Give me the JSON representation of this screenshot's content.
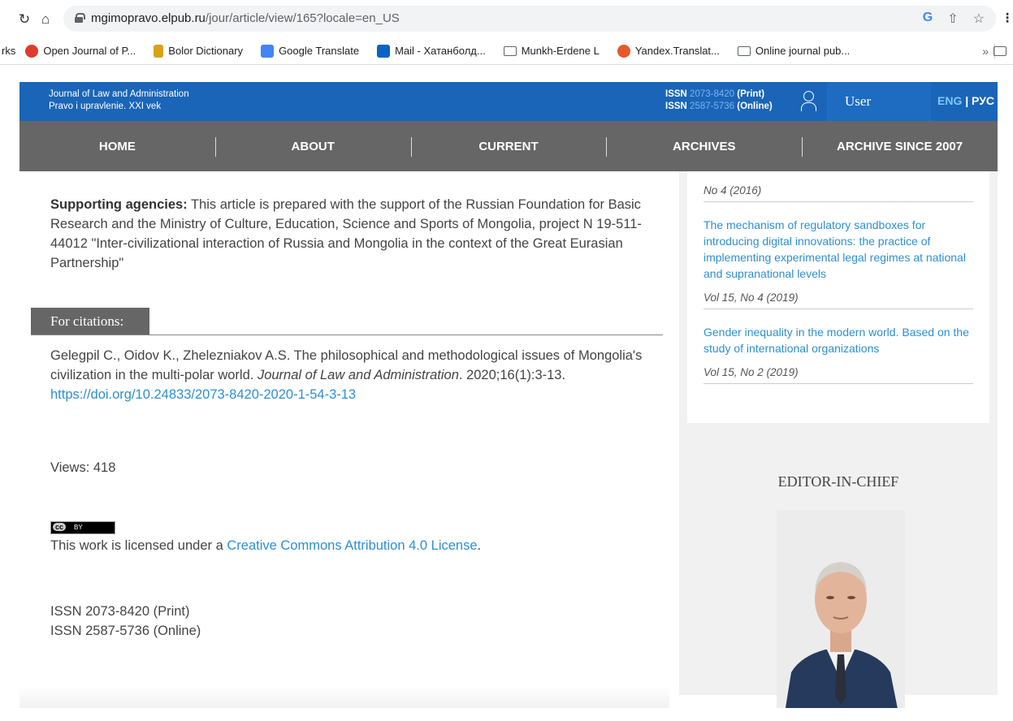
{
  "browser": {
    "back_icon": "↻",
    "home_icon": "⌂",
    "url_domain": "mgimopravo.elpub.ru",
    "url_path": "/jour/article/view/165?locale=en_US",
    "bookmarks": [
      {
        "label": "rks",
        "icon": "none"
      },
      {
        "label": "Open Journal of P...",
        "icon": "ojs-icon",
        "color": "#e03c2e"
      },
      {
        "label": "Bolor Dictionary",
        "icon": "bolor-icon",
        "color": "#d9a21b"
      },
      {
        "label": "Google Translate",
        "icon": "translate-icon",
        "color": "#4285f4"
      },
      {
        "label": "Mail - Хатанболд...",
        "icon": "outlook-icon",
        "color": "#0a64c4"
      },
      {
        "label": "Munkh-Erdene L",
        "icon": "folder-icon"
      },
      {
        "label": "Yandex.Translat...",
        "icon": "yandex-icon",
        "color": "#e8572a"
      },
      {
        "label": "Online journal pub...",
        "icon": "folder-icon"
      }
    ],
    "more_label": "»"
  },
  "header": {
    "journal_line1": "Journal of Law and Administration",
    "journal_line2": "Pravo i upravlenie. XXI vek",
    "issn_label": "ISSN",
    "issn_print_num": "2073-8420",
    "issn_print_type": "(Print)",
    "issn_online_num": "2587-5736",
    "issn_online_type": "(Online)",
    "user_label": "User",
    "lang_eng": "ENG",
    "lang_sep": " | ",
    "lang_rus": "РУС"
  },
  "menu": [
    "HOME",
    "ABOUT",
    "CURRENT",
    "ARCHIVES",
    "ARCHIVE SINCE 2007"
  ],
  "article": {
    "support_label": "Supporting agencies:",
    "support_text": " This article is prepared with the support of the Russian Foundation for Basic Research and the Ministry of Culture, Education, Science and Sports of Mongolia, project N 19-511-44012 \"Inter-civilizational interaction of Russia and Mongolia in the context of the Great Eurasian Partnership\"",
    "citations_heading": "For citations:",
    "citation_authors": "Gelegpil C., Oidov K., Zhelezniakov A.S. The philosophical and methodological issues of Mongolia's civilization in the multi-polar world. ",
    "citation_journal": "Journal of Law and Administration",
    "citation_rest": ". 2020;16(1):3-13. ",
    "citation_doi": "https://doi.org/10.24833/2073-8420-2020-1-54-3-13",
    "views": "Views: 418",
    "cc_badge": "cc",
    "cc_by": "BY",
    "license_prefix": "This work is licensed under a ",
    "license_link": "Creative Commons Attribution 4.0 License",
    "license_suffix": ".",
    "issn_print": "ISSN 2073-8420 (Print)",
    "issn_online": "ISSN 2587-5736 (Online)"
  },
  "sidebar": {
    "top_meta": "No 4 (2016)",
    "related": [
      {
        "title": "The mechanism of regulatory sandboxes for introducing digital innovations: the practice of implementing experimental legal regimes at national and supranational levels",
        "meta": "Vol 15, No 4 (2019)"
      },
      {
        "title": "Gender inequality in the modern world. Based on the study of international organizations",
        "meta": "Vol 15, No 2 (2019)"
      }
    ],
    "editor_heading": "EDITOR-IN-CHIEF"
  }
}
